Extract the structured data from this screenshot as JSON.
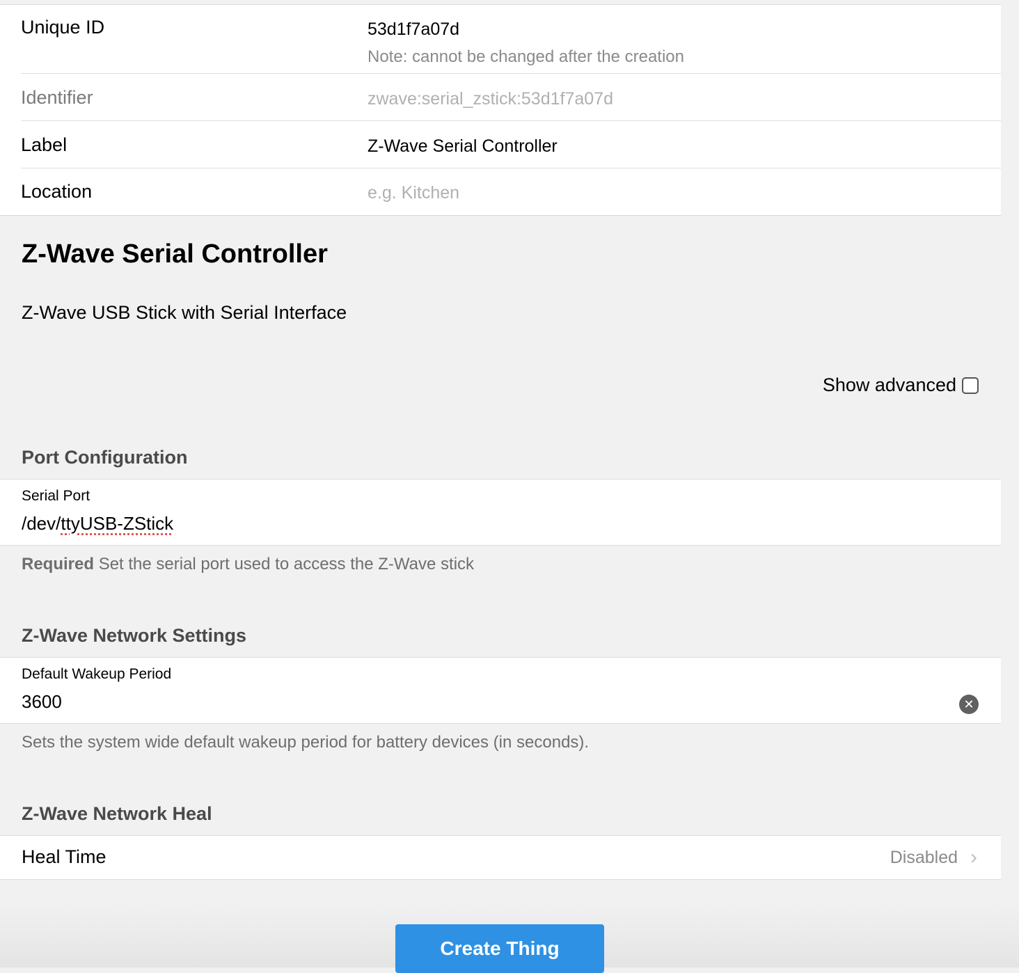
{
  "info": {
    "unique_id_label": "Unique ID",
    "unique_id_value": "53d1f7a07d",
    "unique_id_note": "Note: cannot be changed after the creation",
    "identifier_label": "Identifier",
    "identifier_value": "zwave:serial_zstick:53d1f7a07d",
    "label_label": "Label",
    "label_value": "Z-Wave Serial Controller",
    "location_label": "Location",
    "location_placeholder": "e.g. Kitchen"
  },
  "thing": {
    "title": "Z-Wave Serial Controller",
    "description": "Z-Wave USB Stick with Serial Interface",
    "show_advanced_label": "Show advanced"
  },
  "port_config": {
    "title": "Port Configuration",
    "serial_port_label": "Serial Port",
    "serial_port_prefix": "/dev/",
    "serial_port_suffix": "ttyUSB-ZStick",
    "hint_required": "Required",
    "hint_text": "Set the serial port used to access the Z-Wave stick"
  },
  "network_settings": {
    "title": "Z-Wave Network Settings",
    "wakeup_label": "Default Wakeup Period",
    "wakeup_value": "3600",
    "wakeup_hint": "Sets the system wide default wakeup period for battery devices (in seconds)."
  },
  "network_heal": {
    "title": "Z-Wave Network Heal",
    "heal_time_label": "Heal Time",
    "heal_time_value": "Disabled"
  },
  "actions": {
    "create_label": "Create Thing"
  }
}
